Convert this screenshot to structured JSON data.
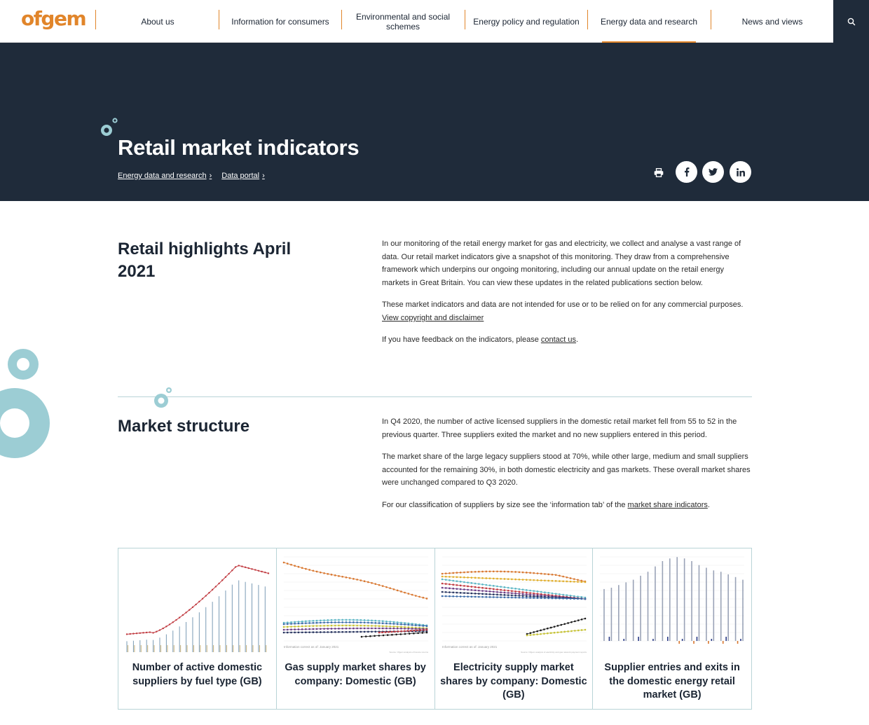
{
  "header": {
    "logo": "ofgem",
    "nav": [
      {
        "label": "About us",
        "active": false
      },
      {
        "label": "Information for consumers",
        "active": false
      },
      {
        "label": "Environmental and social schemes",
        "active": false
      },
      {
        "label": "Energy policy and regulation",
        "active": false
      },
      {
        "label": "Energy data and research",
        "active": true
      },
      {
        "label": "News and views",
        "active": false
      }
    ],
    "search_icon": "search-icon"
  },
  "hero": {
    "title": "Retail market indicators",
    "breadcrumbs": [
      "Energy data and research",
      "Data portal"
    ],
    "share_icons": [
      "print-icon",
      "facebook-icon",
      "twitter-icon",
      "linkedin-icon"
    ]
  },
  "highlights": {
    "title": "Retail highlights April 2021",
    "para1": "In our monitoring of the retail energy market for gas and electricity, we collect and analyse a vast range of data. Our retail market indicators give a snapshot of this monitoring. They draw from a comprehensive framework which underpins our ongoing monitoring, including our annual update on the retail energy markets in Great Britain. You can view these updates in the related publications section below.",
    "para2_text": "These market indicators and data are not intended for use or to be relied on for any commercial purposes.",
    "para2_link": "View copyright and disclaimer",
    "para3_text": "If you have feedback on the indicators, please",
    "para3_link": "contact us",
    "para3_end": "."
  },
  "market_structure": {
    "title": "Market structure",
    "para1": "In Q4 2020, the number of active licensed suppliers in the domestic retail market fell from 55 to 52  in the previous quarter. Three suppliers exited the market and no new suppliers entered in this period.",
    "para2": "The market share of the large legacy suppliers stood at 70%, while other large, medium and small suppliers accounted for the remaining 30%, in both domestic electricity and gas markets. These overall market shares were unchanged compared to Q3 2020.",
    "para3_text": "For our classification of suppliers by size see the ‘information tab’ of the",
    "para3_link": "market share indicators",
    "para3_end": "."
  },
  "cards": [
    {
      "title": "Number of active domestic suppliers by fuel type (GB)",
      "caption": "",
      "source": ""
    },
    {
      "title": "Gas supply market shares by company: Domestic (GB)",
      "caption": "Information correct as of: January 2021",
      "source": "Source: Ofgem analysis of licence returns"
    },
    {
      "title": "Electricity supply market shares by company: Domestic (GB)",
      "caption": "Information correct as of: January 2021",
      "source": "Source: Ofgem analysis of electricity and gas network payment reports"
    },
    {
      "title": "Supplier entries and exits in the domestic energy retail market (GB)",
      "caption": "",
      "source": ""
    }
  ],
  "colors": {
    "accent": "#e1852a",
    "navy": "#1f2b3a",
    "teal": "#9ccdd4"
  }
}
